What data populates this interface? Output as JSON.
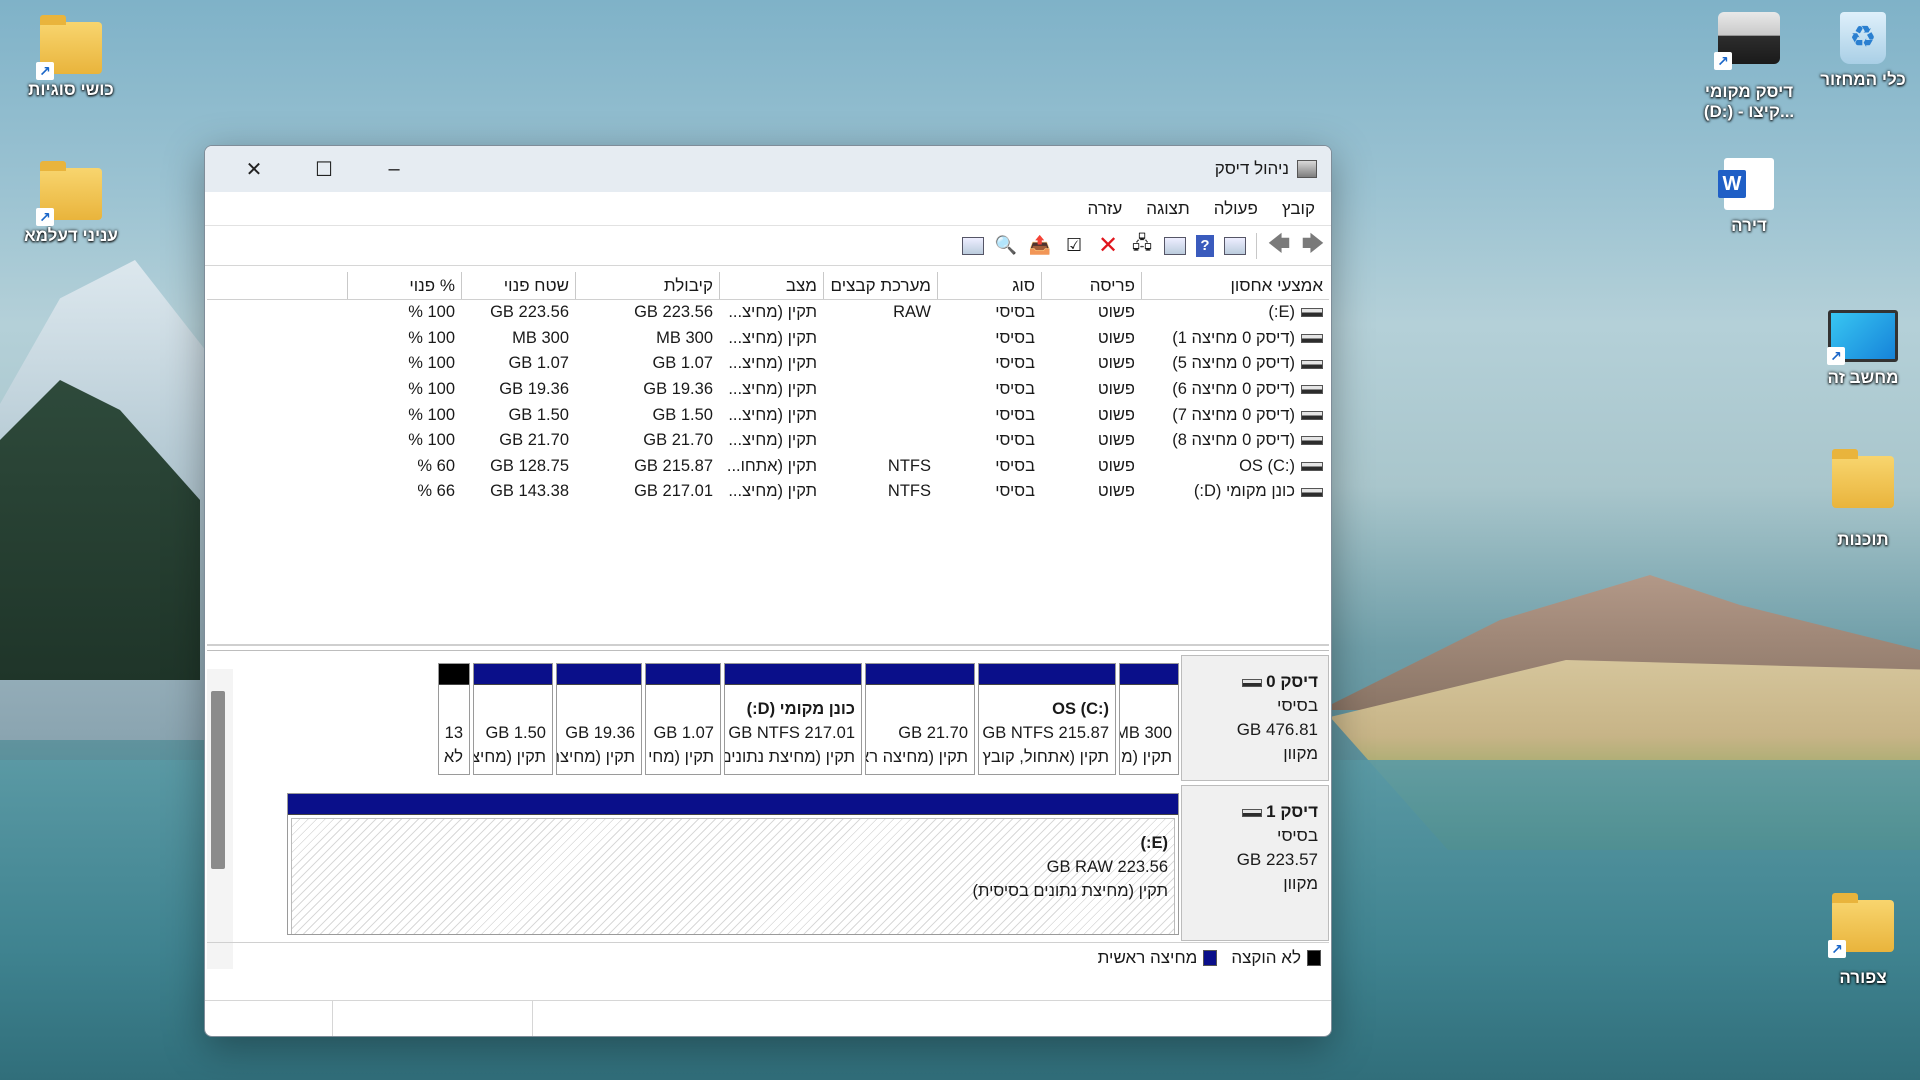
{
  "desktop": {
    "icons": [
      {
        "label": "כלי המחזור",
        "icon": "recycle-bin-icon"
      },
      {
        "label": "דיסק מקומי (D:) - קיצו...",
        "icon": "drive-icon"
      },
      {
        "label": "דירה",
        "icon": "word-document-icon"
      },
      {
        "label": "מחשב זה",
        "icon": "computer-icon"
      },
      {
        "label": "תוכנות",
        "icon": "folder-icon"
      },
      {
        "label": "צפורה",
        "icon": "folder-icon"
      },
      {
        "label": "כושי סוגיות",
        "icon": "folder-icon"
      },
      {
        "label": "עניני דעלמא",
        "icon": "folder-icon"
      }
    ]
  },
  "window": {
    "title": "ניהול דיסק",
    "controls": {
      "minimize": "–",
      "maximize": "☐",
      "close": "✕"
    },
    "menu": [
      "קובץ",
      "פעולה",
      "תצוגה",
      "עזרה"
    ]
  },
  "table": {
    "headers": [
      "אמצעי אחסון",
      "פריסה",
      "סוג",
      "מערכת קבצים",
      "מצב",
      "קיבולת",
      "שטח פנוי",
      "% פנוי"
    ],
    "rows": [
      {
        "volume": "(E:)",
        "layout": "פשוט",
        "type": "בסיסי",
        "fs": "RAW",
        "status": "תקין (מחיצ...",
        "capacity": "223.56 GB",
        "free": "223.56 GB",
        "pct": "100 %"
      },
      {
        "volume": "(דיסק 0 מחיצה 1)",
        "layout": "פשוט",
        "type": "בסיסי",
        "fs": "",
        "status": "תקין (מחיצ...",
        "capacity": "300 MB",
        "free": "300 MB",
        "pct": "100 %"
      },
      {
        "volume": "(דיסק 0 מחיצה 5)",
        "layout": "פשוט",
        "type": "בסיסי",
        "fs": "",
        "status": "תקין (מחיצ...",
        "capacity": "1.07 GB",
        "free": "1.07 GB",
        "pct": "100 %"
      },
      {
        "volume": "(דיסק 0 מחיצה 6)",
        "layout": "פשוט",
        "type": "בסיסי",
        "fs": "",
        "status": "תקין (מחיצ...",
        "capacity": "19.36 GB",
        "free": "19.36 GB",
        "pct": "100 %"
      },
      {
        "volume": "(דיסק 0 מחיצה 7)",
        "layout": "פשוט",
        "type": "בסיסי",
        "fs": "",
        "status": "תקין (מחיצ...",
        "capacity": "1.50 GB",
        "free": "1.50 GB",
        "pct": "100 %"
      },
      {
        "volume": "(דיסק 0 מחיצה 8)",
        "layout": "פשוט",
        "type": "בסיסי",
        "fs": "",
        "status": "תקין (מחיצ...",
        "capacity": "21.70 GB",
        "free": "21.70 GB",
        "pct": "100 %"
      },
      {
        "volume": "OS (C:)",
        "layout": "פשוט",
        "type": "בסיסי",
        "fs": "NTFS",
        "status": "תקין (אתחו...",
        "capacity": "215.87 GB",
        "free": "128.75 GB",
        "pct": "60 %"
      },
      {
        "volume": "כונן מקומי (D:)",
        "layout": "פשוט",
        "type": "בסיסי",
        "fs": "NTFS",
        "status": "תקין (מחיצ...",
        "capacity": "217.01 GB",
        "free": "143.38 GB",
        "pct": "66 %"
      }
    ]
  },
  "disks": [
    {
      "name": "דיסק 0",
      "type": "בסיסי",
      "size": "476.81 GB",
      "state": "מקוון",
      "partitions": [
        {
          "l1": "",
          "l2": "300 MB",
          "l3": "תקין (מ"
        },
        {
          "l1": "OS (C:)",
          "l2": "215.87 GB NTFS",
          "l3": "תקין (אתחול, קובץ ר"
        },
        {
          "l1": "",
          "l2": "21.70 GB",
          "l3": "תקין (מחיצה רא"
        },
        {
          "l1": "כונן מקומי (D:)",
          "l2": "217.01 GB NTFS",
          "l3": "תקין (מחיצת נתונים"
        },
        {
          "l1": "",
          "l2": "1.07 GB",
          "l3": "תקין (מחי"
        },
        {
          "l1": "",
          "l2": "19.36 GB",
          "l3": "תקין (מחיצת ש"
        },
        {
          "l1": "",
          "l2": "1.50 GB",
          "l3": "תקין (מחיצ"
        },
        {
          "l1": "",
          "l2": "13",
          "l3": "לא",
          "unallocated": true
        }
      ]
    },
    {
      "name": "דיסק 1",
      "type": "בסיסי",
      "size": "223.57 GB",
      "state": "מקוון",
      "partitions": [
        {
          "l1": "(E:)",
          "l2": "223.56 GB RAW",
          "l3": "תקין (מחיצת נתונים בסיסית)"
        }
      ]
    }
  ],
  "legend": [
    {
      "label": "לא הוקצה",
      "color": "#000000"
    },
    {
      "label": "מחיצה ראשית",
      "color": "#0a0f8a"
    }
  ]
}
